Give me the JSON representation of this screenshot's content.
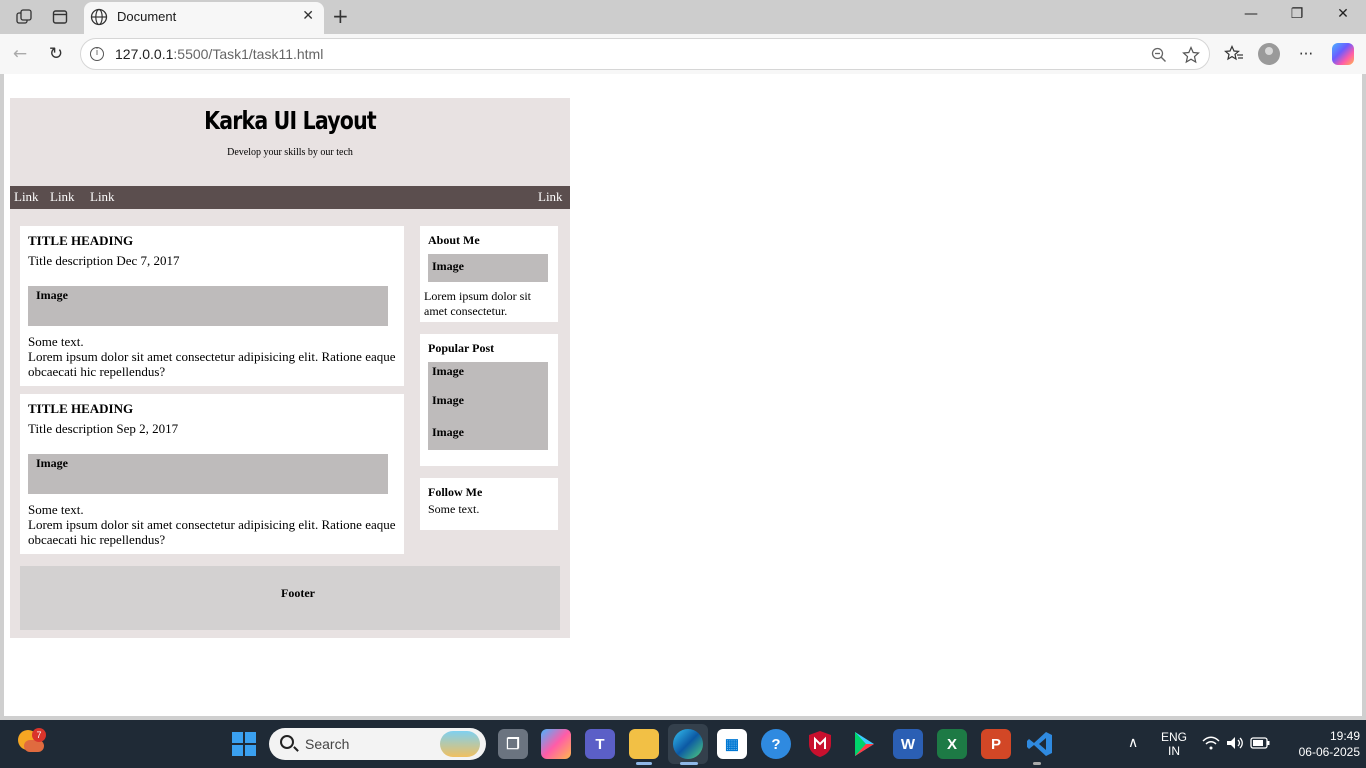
{
  "browser": {
    "tab_title": "Document",
    "url_host": "127.0.0.1",
    "url_rest": ":5500/Task1/task11.html"
  },
  "page": {
    "title": "Karka UI Layout",
    "subtitle": "Develop your skills by our tech",
    "nav_links": [
      "Link",
      "Link",
      "Link",
      "Link"
    ],
    "posts": [
      {
        "heading": "TITLE HEADING",
        "description": "Title description Dec 7, 2017",
        "image_label": "Image",
        "text_line1": "Some text.",
        "text_line2": "Lorem ipsum dolor sit amet consectetur adipisicing elit. Ratione eaque obcaecati hic repellendus?"
      },
      {
        "heading": "TITLE HEADING",
        "description": "Title description Sep 2, 2017",
        "image_label": "Image",
        "text_line1": "Some text.",
        "text_line2": "Lorem ipsum dolor sit amet consectetur adipisicing elit. Ratione eaque obcaecati hic repellendus?"
      }
    ],
    "sidebar": {
      "about": {
        "heading": "About Me",
        "image_label": "Image",
        "text": "Lorem ipsum dolor sit amet consectetur."
      },
      "popular": {
        "heading": "Popular Post",
        "image_labels": [
          "Image",
          "Image",
          "Image"
        ]
      },
      "follow": {
        "heading": "Follow Me",
        "text": "Some text."
      }
    },
    "footer": "Footer"
  },
  "taskbar": {
    "weather_badge": "7",
    "search_placeholder": "Search",
    "language_line1": "ENG",
    "language_line2": "IN",
    "time": "19:49",
    "date": "06-06-2025",
    "colors": {
      "word": "#2b5fb4",
      "excel": "#1d7a45",
      "powerpoint": "#d24726",
      "vscode": "#2f8ae0",
      "mcafee": "#c8102e"
    }
  }
}
